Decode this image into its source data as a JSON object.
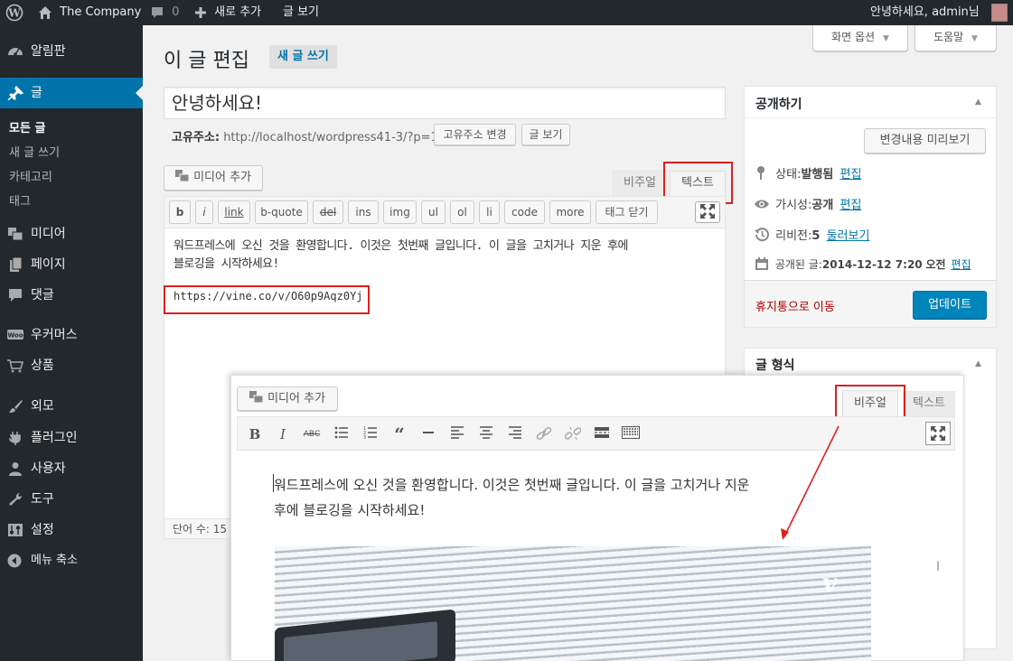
{
  "adminbar": {
    "site": "The Company",
    "comments": "0",
    "new": "새로 추가",
    "view": "글 보기",
    "greeting": "안녕하세요, admin님"
  },
  "menu": {
    "dashboard": "알림판",
    "posts": "글",
    "sub_all": "모든 글",
    "sub_new": "새 글 쓰기",
    "sub_cat": "카테고리",
    "sub_tag": "태그",
    "media": "미디어",
    "pages": "페이지",
    "comments": "댓글",
    "woo": "우커머스",
    "products": "상품",
    "appearance": "외모",
    "plugins": "플러그인",
    "users": "사용자",
    "tools": "도구",
    "settings": "설정",
    "collapse": "메뉴 축소"
  },
  "screen_options": "화면 옵션",
  "help": "도움말",
  "page_title": "이 글 편집",
  "add_new": "새 글 쓰기",
  "post_title": "안녕하세요!",
  "permalink": {
    "label": "고유주소:",
    "url": "http://localhost/wordpress41-3/?p=1",
    "change": "고유주소 변경",
    "view": "글 보기"
  },
  "editor": {
    "add_media": "미디어 추가",
    "tab_visual": "비주얼",
    "tab_text": "텍스트",
    "qt_buttons": [
      "b",
      "i",
      "link",
      "b-quote",
      "del",
      "ins",
      "img",
      "ul",
      "ol",
      "li",
      "code",
      "more",
      "태그 닫기"
    ],
    "text_line1": "워드프레스에 오신 것을 환영합니다. 이것은 첫번째 글입니다. 이 글을 고치거나 지운 후에",
    "text_line2": "블로깅을 시작하세요!",
    "vine_url": "https://vine.co/v/O60p9Aqz0Yj",
    "word_count": "단어 수: 15"
  },
  "overlay": {
    "add_media": "미디어 추가",
    "tab_visual": "비주얼",
    "tab_text": "텍스트",
    "line1": "워드프레스에 오신 것을 환영합니다. 이것은 첫번째 글입니다. 이 글을 고치거나 지운",
    "line2": "후에 블로깅을 시작하세요!"
  },
  "publish": {
    "title": "공개하기",
    "preview": "변경내용 미리보기",
    "status_label": "상태:",
    "status_value": "발행됨",
    "edit": "편집",
    "visibility_label": "가시성:",
    "visibility_value": "공개",
    "revisions_label": "리비전:",
    "revisions_count": "5",
    "revisions_link": "둘러보기",
    "published_label": "공개된 글:",
    "published_date": "2014-12-12 7:20",
    "published_ampm": "오전",
    "trash": "휴지통으로 이동",
    "update": "업데이트"
  },
  "format_box": {
    "title": "글 형식"
  },
  "colors": {
    "adminbar": "#23282d",
    "accent": "#0073aa",
    "annotation": "#dd1f1f",
    "update_button": "#0085ba"
  }
}
